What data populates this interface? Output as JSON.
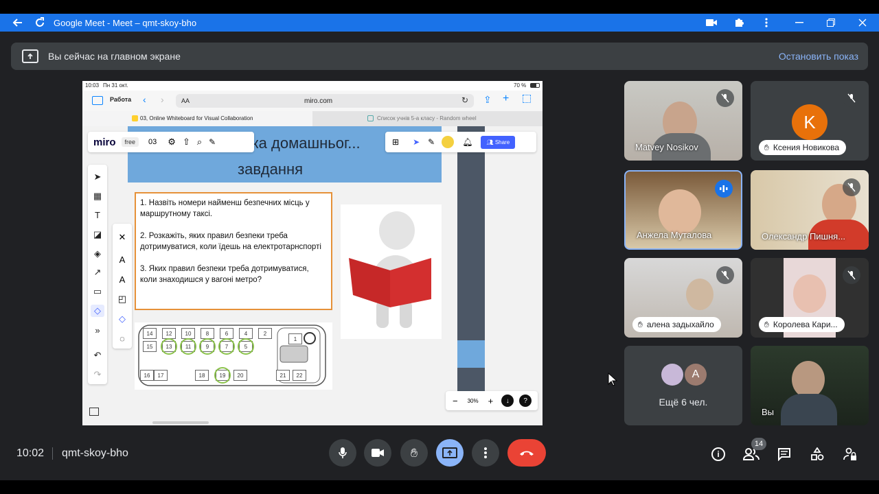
{
  "window": {
    "title": "Google Meet - Meet – qmt-skoy-bho"
  },
  "banner": {
    "text": "Вы сейчас на главном экране",
    "stop": "Остановить показ"
  },
  "ipad": {
    "time": "10:03",
    "date": "Пн 31 окт.",
    "battery": "70 %",
    "sidebar_label": "Работа",
    "url_aa": "AA",
    "url": "miro.com",
    "tab1": "03, Online Whiteboard for Visual Collaboration",
    "tab2": "Список учнів 5-а класу - Random wheel"
  },
  "miro": {
    "logo": "miro",
    "plan": "free",
    "board": "03",
    "share": "Share",
    "zoom": "30%",
    "title_line1": "...рка домашньог...",
    "title_line2": "завдання",
    "questions": [
      "1. Назвіть номери найменш безпечних місць у маршрутному таксі.",
      "2. Розкажіть, яких правил безпеки треба дотримуватися, коли їдешь на електротарнспорті",
      "3. Яких правил безпеки треба дотримуватися, коли знаходишся у вагоні метро?"
    ],
    "seats_top": [
      "14",
      "12",
      "10",
      "8",
      "6",
      "4",
      "2"
    ],
    "seats_mid": [
      "15",
      "13",
      "11",
      "9",
      "7",
      "5"
    ],
    "seats_bottom": [
      "16",
      "17",
      "18",
      "19",
      "20",
      "21",
      "22"
    ],
    "seat_driver": "1"
  },
  "participants": [
    {
      "name": "Matvey Nosikov",
      "muted": true
    },
    {
      "name": "Ксения Новикова",
      "initial": "K",
      "color": "#e8710a",
      "muted": true
    },
    {
      "name": "Анжела Муталова",
      "speaking": true
    },
    {
      "name": "Олександр Пишня...",
      "muted": true
    },
    {
      "name": "алена задыхайло",
      "muted": true
    },
    {
      "name": "Королева Кари...",
      "muted": true
    },
    {
      "name": "Ещё 6 чел.",
      "initial": "A"
    },
    {
      "name": "Вы"
    }
  ],
  "bottom": {
    "time": "10:02",
    "code": "qmt-skoy-bho",
    "people_badge": "14"
  },
  "colors": {
    "accent": "#1a73e8",
    "end_call": "#ea4335",
    "present": "#8ab4f8",
    "bg": "#202124"
  }
}
